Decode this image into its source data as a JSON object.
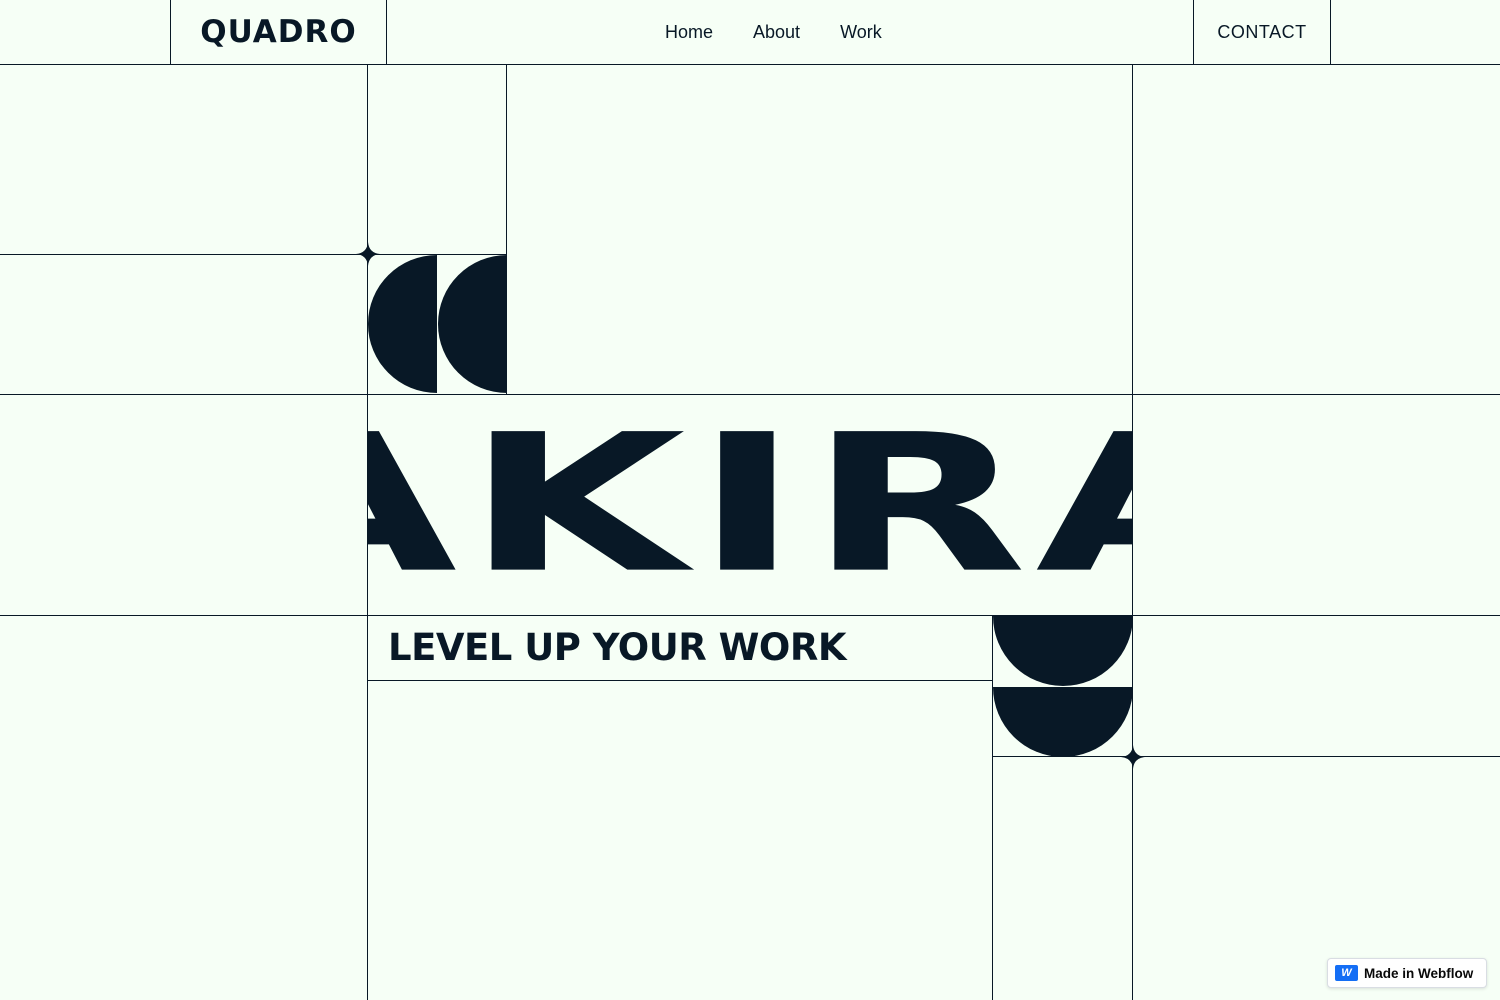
{
  "header": {
    "logo": "QUADRO",
    "nav": [
      "Home",
      "About",
      "Work"
    ],
    "contact": "CONTACT"
  },
  "hero": {
    "title": "AKIRA",
    "tagline": "LEVEL UP YOUR WORK"
  },
  "badge": {
    "label": "Made in Webflow",
    "icon": "webflow-logo-icon"
  },
  "colors": {
    "background": "#f6fff6",
    "ink": "#081826",
    "badge_accent": "#146ef5"
  }
}
